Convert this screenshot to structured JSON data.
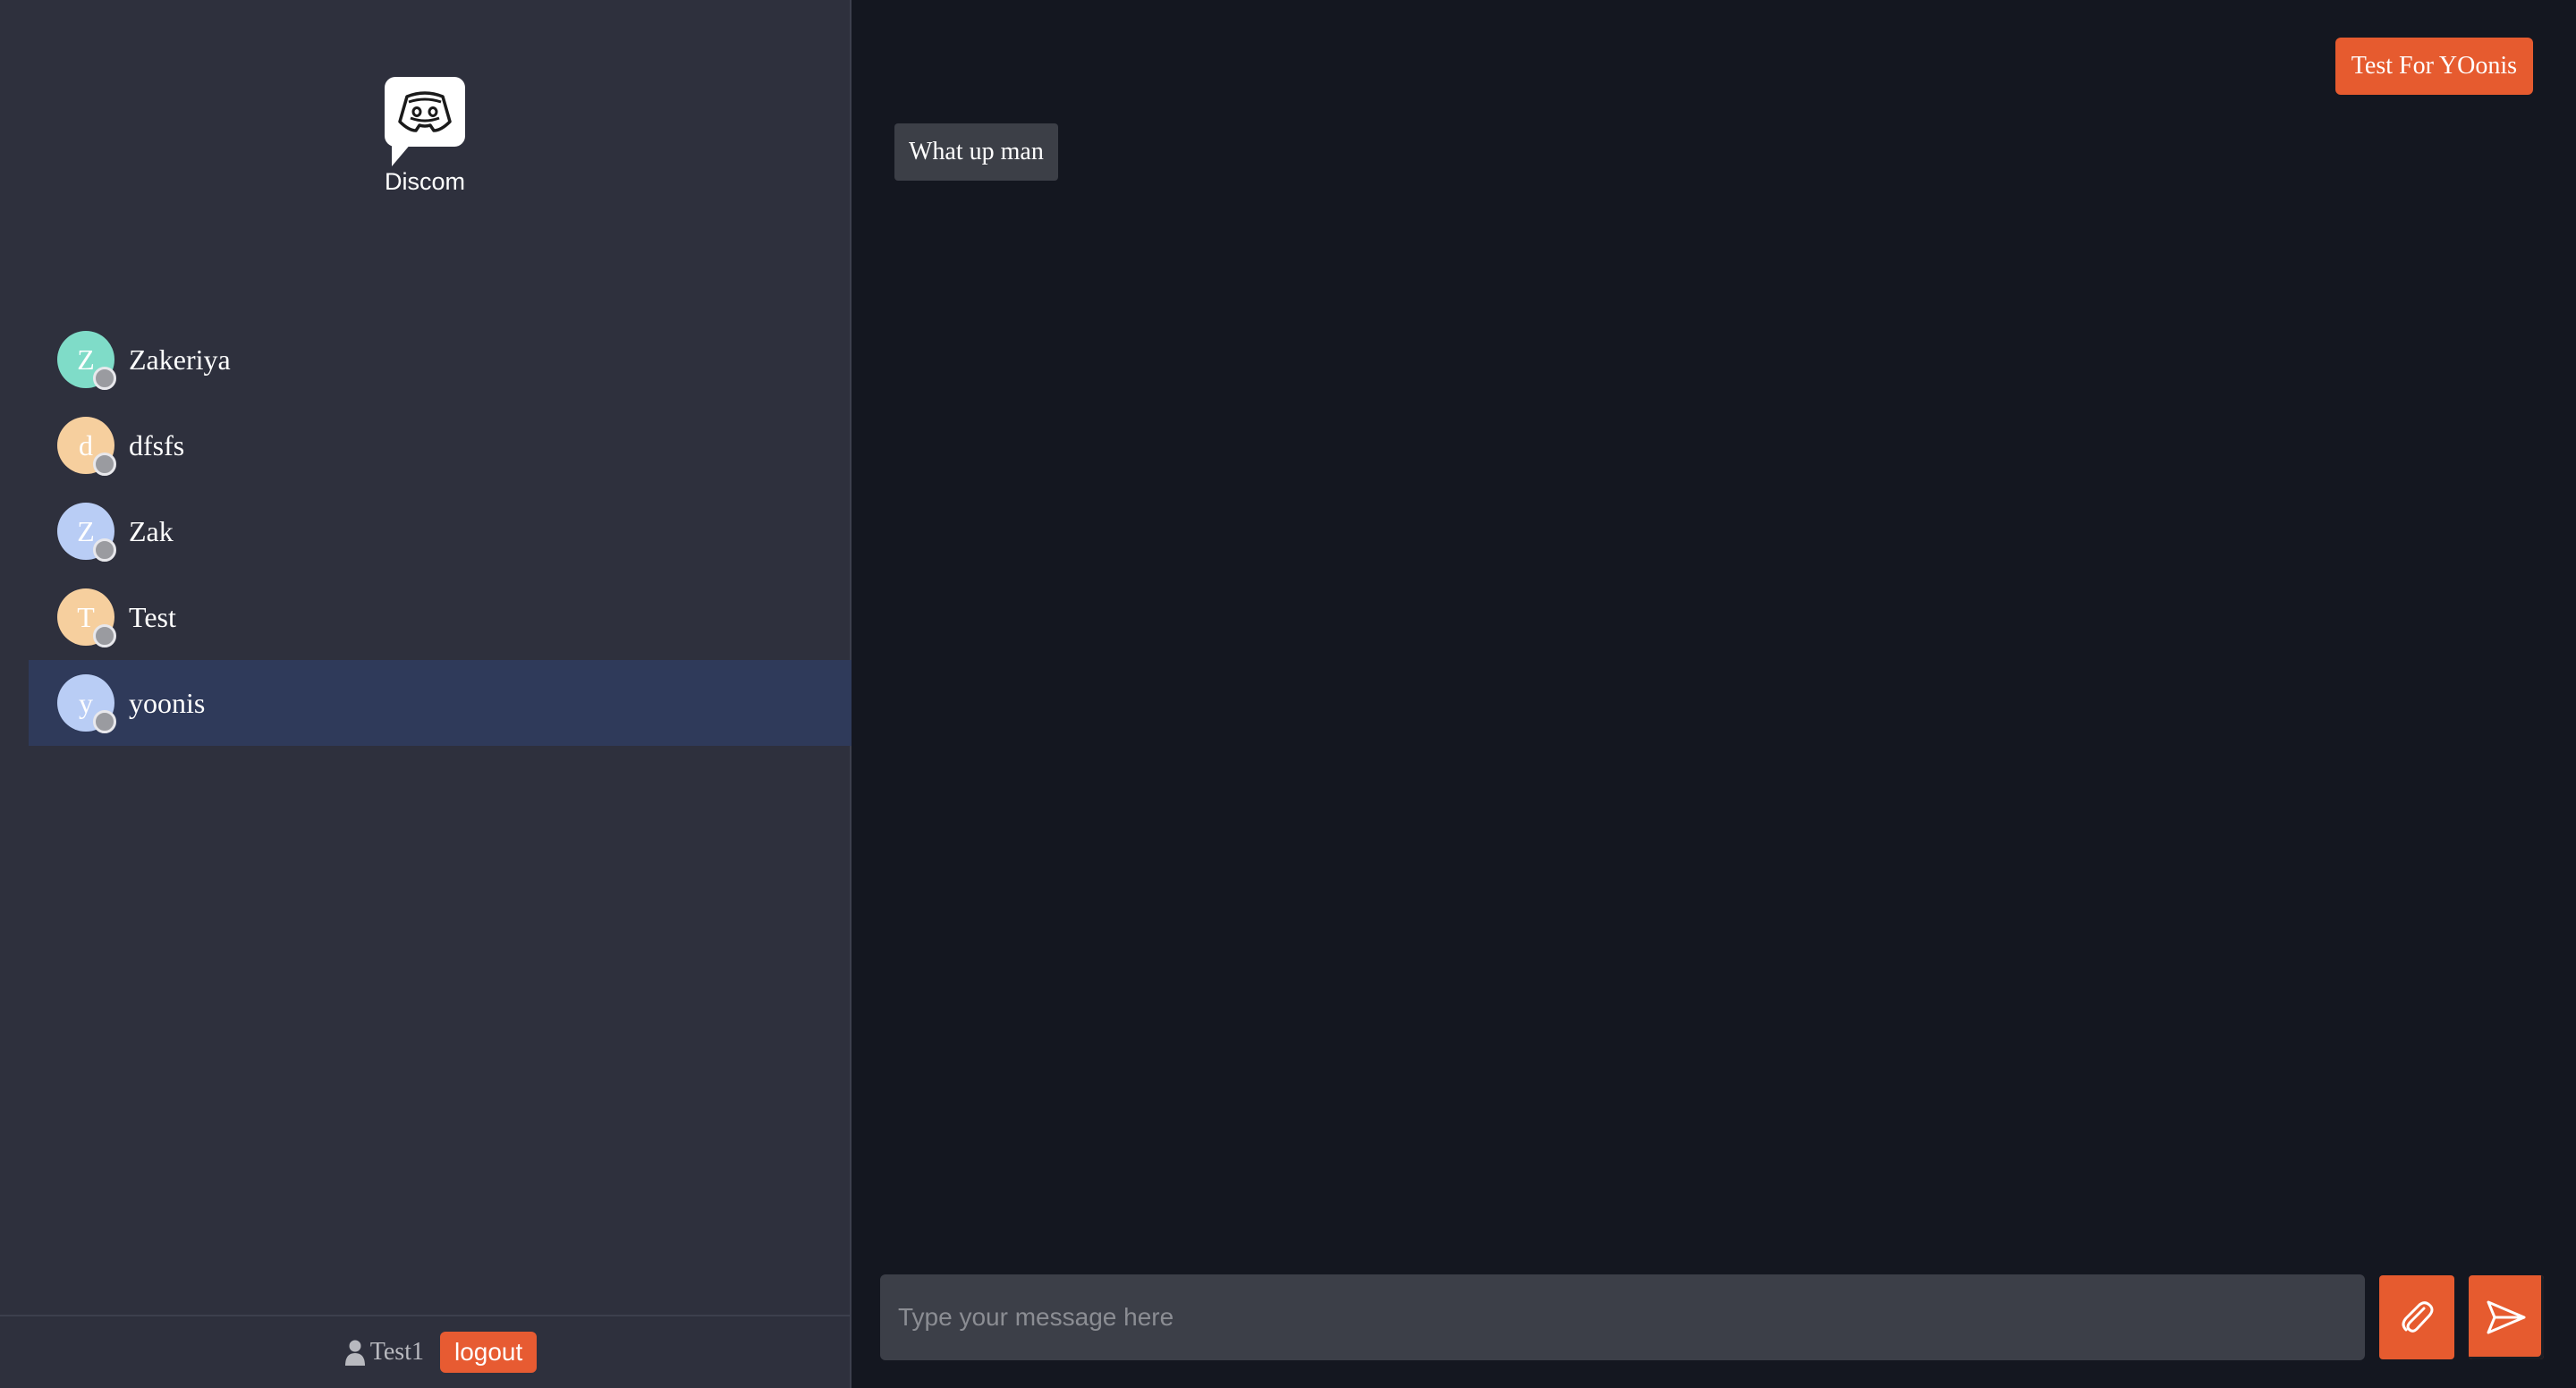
{
  "brand": {
    "name": "Discom",
    "icon": "discord-icon"
  },
  "contacts": [
    {
      "name": "Zakeriya",
      "initial": "Z",
      "color": "#7fdcc8",
      "active": false
    },
    {
      "name": "dfsfs",
      "initial": "d",
      "color": "#f6cf9e",
      "active": false
    },
    {
      "name": "Zak",
      "initial": "Z",
      "color": "#b9cdf5",
      "active": false
    },
    {
      "name": "Test",
      "initial": "T",
      "color": "#f6cf9e",
      "active": false
    },
    {
      "name": "yoonis",
      "initial": "y",
      "color": "#b9cdf5",
      "active": true
    }
  ],
  "footer": {
    "username": "Test1",
    "user_icon": "user-icon",
    "logout_label": "logout"
  },
  "chat": {
    "header_button": "Test For YOonis",
    "messages": [
      {
        "text": "What up man"
      }
    ],
    "input_placeholder": "Type your message here",
    "attach_icon": "paperclip-icon",
    "send_icon": "send-icon"
  },
  "colors": {
    "accent": "#e65b2f",
    "sidebar_bg": "#2e303d",
    "main_bg": "#141720",
    "active_row": "#2f3a5a"
  }
}
